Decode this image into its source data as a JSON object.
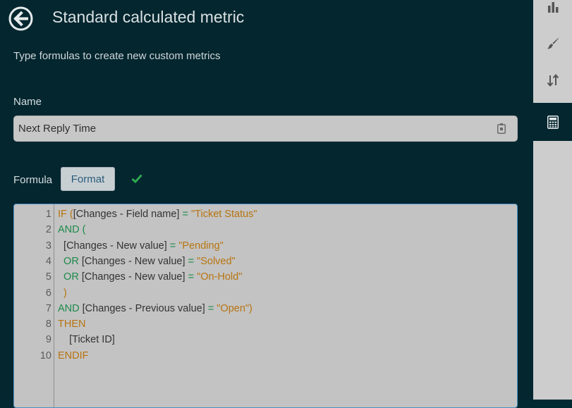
{
  "header": {
    "title": "Standard calculated metric",
    "back_icon": "arrow-left-circle-icon"
  },
  "subtitle": "Type formulas to create new custom metrics",
  "name_section": {
    "label": "Name",
    "value": "Next Reply Time",
    "icon": "clipboard-icon"
  },
  "formula_section": {
    "label": "Formula",
    "format_button": "Format",
    "status_icon": "checkmark-icon"
  },
  "editor": {
    "line_numbers": [
      "1",
      "2",
      "3",
      "4",
      "5",
      "6",
      "7",
      "8",
      "9",
      "10"
    ],
    "lines": [
      [
        {
          "t": "IF (",
          "c": "kw2"
        },
        {
          "t": "[Changes - Field name] ",
          "c": "id"
        },
        {
          "t": "= ",
          "c": "op"
        },
        {
          "t": "\"Ticket Status\"",
          "c": "str"
        }
      ],
      [
        {
          "t": "AND (",
          "c": "kw"
        }
      ],
      [
        {
          "t": "  [Changes - New value] ",
          "c": "id"
        },
        {
          "t": "= ",
          "c": "op"
        },
        {
          "t": "\"Pending\"",
          "c": "str"
        }
      ],
      [
        {
          "t": "  OR ",
          "c": "kw"
        },
        {
          "t": "[Changes - New value] ",
          "c": "id"
        },
        {
          "t": "= ",
          "c": "op"
        },
        {
          "t": "\"Solved\"",
          "c": "str"
        }
      ],
      [
        {
          "t": "  OR ",
          "c": "kw"
        },
        {
          "t": "[Changes - New value] ",
          "c": "id"
        },
        {
          "t": "= ",
          "c": "op"
        },
        {
          "t": "\"On-Hold\"",
          "c": "str"
        }
      ],
      [
        {
          "t": "  )",
          "c": "kw2"
        }
      ],
      [
        {
          "t": "AND ",
          "c": "kw"
        },
        {
          "t": "[Changes - Previous value] ",
          "c": "id"
        },
        {
          "t": "= ",
          "c": "op"
        },
        {
          "t": "\"Open\")",
          "c": "str"
        }
      ],
      [
        {
          "t": "THEN",
          "c": "kw2"
        }
      ],
      [
        {
          "t": "    [Ticket ID]",
          "c": "id"
        }
      ],
      [
        {
          "t": "ENDIF",
          "c": "kw2"
        }
      ]
    ]
  },
  "right_panel": {
    "items": [
      {
        "icon": "bar-chart-icon"
      },
      {
        "icon": "paintbrush-icon"
      },
      {
        "icon": "sort-arrows-icon"
      },
      {
        "icon": "calculator-icon",
        "active": true
      }
    ]
  },
  "colors": {
    "background": "#03262f",
    "editor_bg": "#c3c3c3",
    "keyword": "#1d8a4a",
    "string": "#b87410",
    "accent": "#4f90bf",
    "check": "#2fa84f"
  }
}
